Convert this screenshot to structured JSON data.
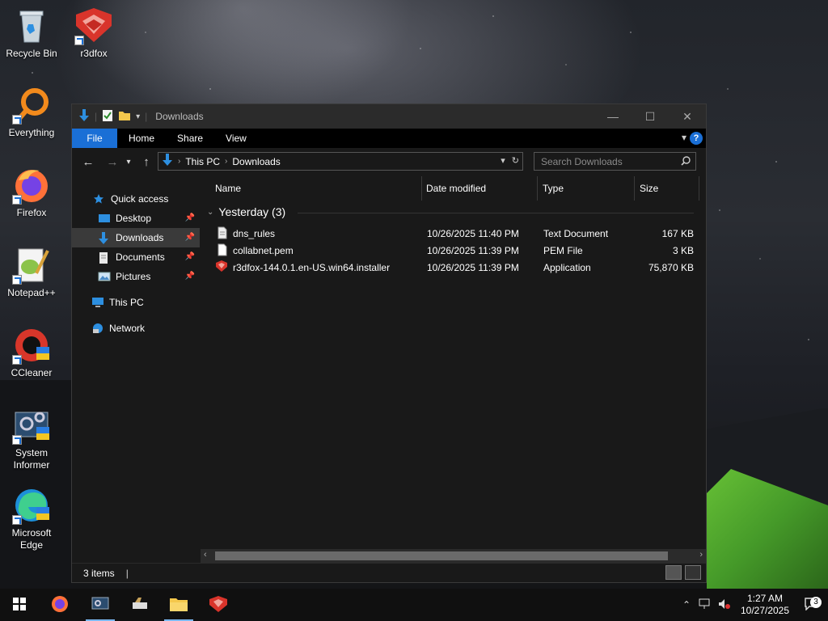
{
  "desktop": {
    "icons": [
      {
        "label": "Recycle Bin",
        "icon": "recycle-bin-icon"
      },
      {
        "label": "r3dfox",
        "icon": "r3dfox-icon"
      },
      {
        "label": "Everything",
        "icon": "everything-icon"
      },
      {
        "label": "Firefox",
        "icon": "firefox-icon"
      },
      {
        "label": "Notepad++",
        "icon": "notepadpp-icon"
      },
      {
        "label": "CCleaner",
        "icon": "ccleaner-icon"
      },
      {
        "label": "System Informer",
        "icon": "system-informer-icon"
      },
      {
        "label": "Microsoft Edge",
        "icon": "edge-icon"
      }
    ]
  },
  "window": {
    "title": "Downloads",
    "ribbon_tabs": [
      "File",
      "Home",
      "Share",
      "View"
    ],
    "address": {
      "segments": [
        "This PC",
        "Downloads"
      ]
    },
    "search": {
      "placeholder": "Search Downloads"
    },
    "nav": {
      "quick_access": "Quick access",
      "items": [
        "Desktop",
        "Downloads",
        "Documents",
        "Pictures"
      ],
      "this_pc": "This PC",
      "network": "Network"
    },
    "columns": [
      "Name",
      "Date modified",
      "Type",
      "Size"
    ],
    "group_label": "Yesterday (3)",
    "files": [
      {
        "name": "dns_rules",
        "date": "10/26/2025 11:40 PM",
        "type": "Text Document",
        "size": "167 KB",
        "icon": "text-file-icon"
      },
      {
        "name": "collabnet.pem",
        "date": "10/26/2025 11:39 PM",
        "type": "PEM File",
        "size": "3 KB",
        "icon": "file-icon"
      },
      {
        "name": "r3dfox-144.0.1.en-US.win64.installer",
        "date": "10/26/2025 11:39 PM",
        "type": "Application",
        "size": "75,870 KB",
        "icon": "r3dfox-icon"
      }
    ],
    "status": {
      "items_count": "3 items"
    }
  },
  "taskbar": {
    "time": "1:27 AM",
    "date": "10/27/2025",
    "notification_count": "3"
  },
  "colors": {
    "accent": "#1a6fd6",
    "window_bg": "#191919",
    "title_bg": "#2b2b2b",
    "selected_bg": "#3a3a3a"
  }
}
